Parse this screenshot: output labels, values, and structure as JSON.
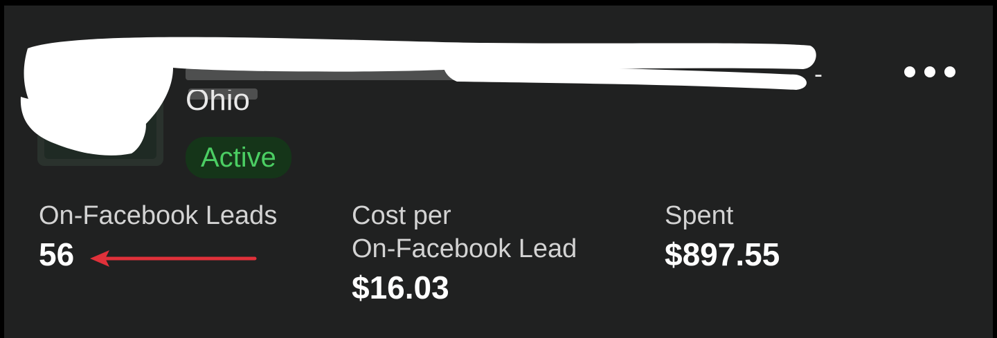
{
  "campaign": {
    "title_visible_fragment": "Ohio",
    "trailing_char": "-",
    "status": "Active",
    "status_color": "#4bce63"
  },
  "menu": {
    "icon": "more-horizontal-icon"
  },
  "metrics": [
    {
      "label": "On-Facebook Leads",
      "value": "56"
    },
    {
      "label_line1": "Cost per",
      "label_line2": "On-Facebook Lead",
      "value": "$16.03"
    },
    {
      "label": "Spent",
      "value": "$897.55"
    }
  ],
  "annotation": {
    "arrow_color": "#e0313a"
  }
}
